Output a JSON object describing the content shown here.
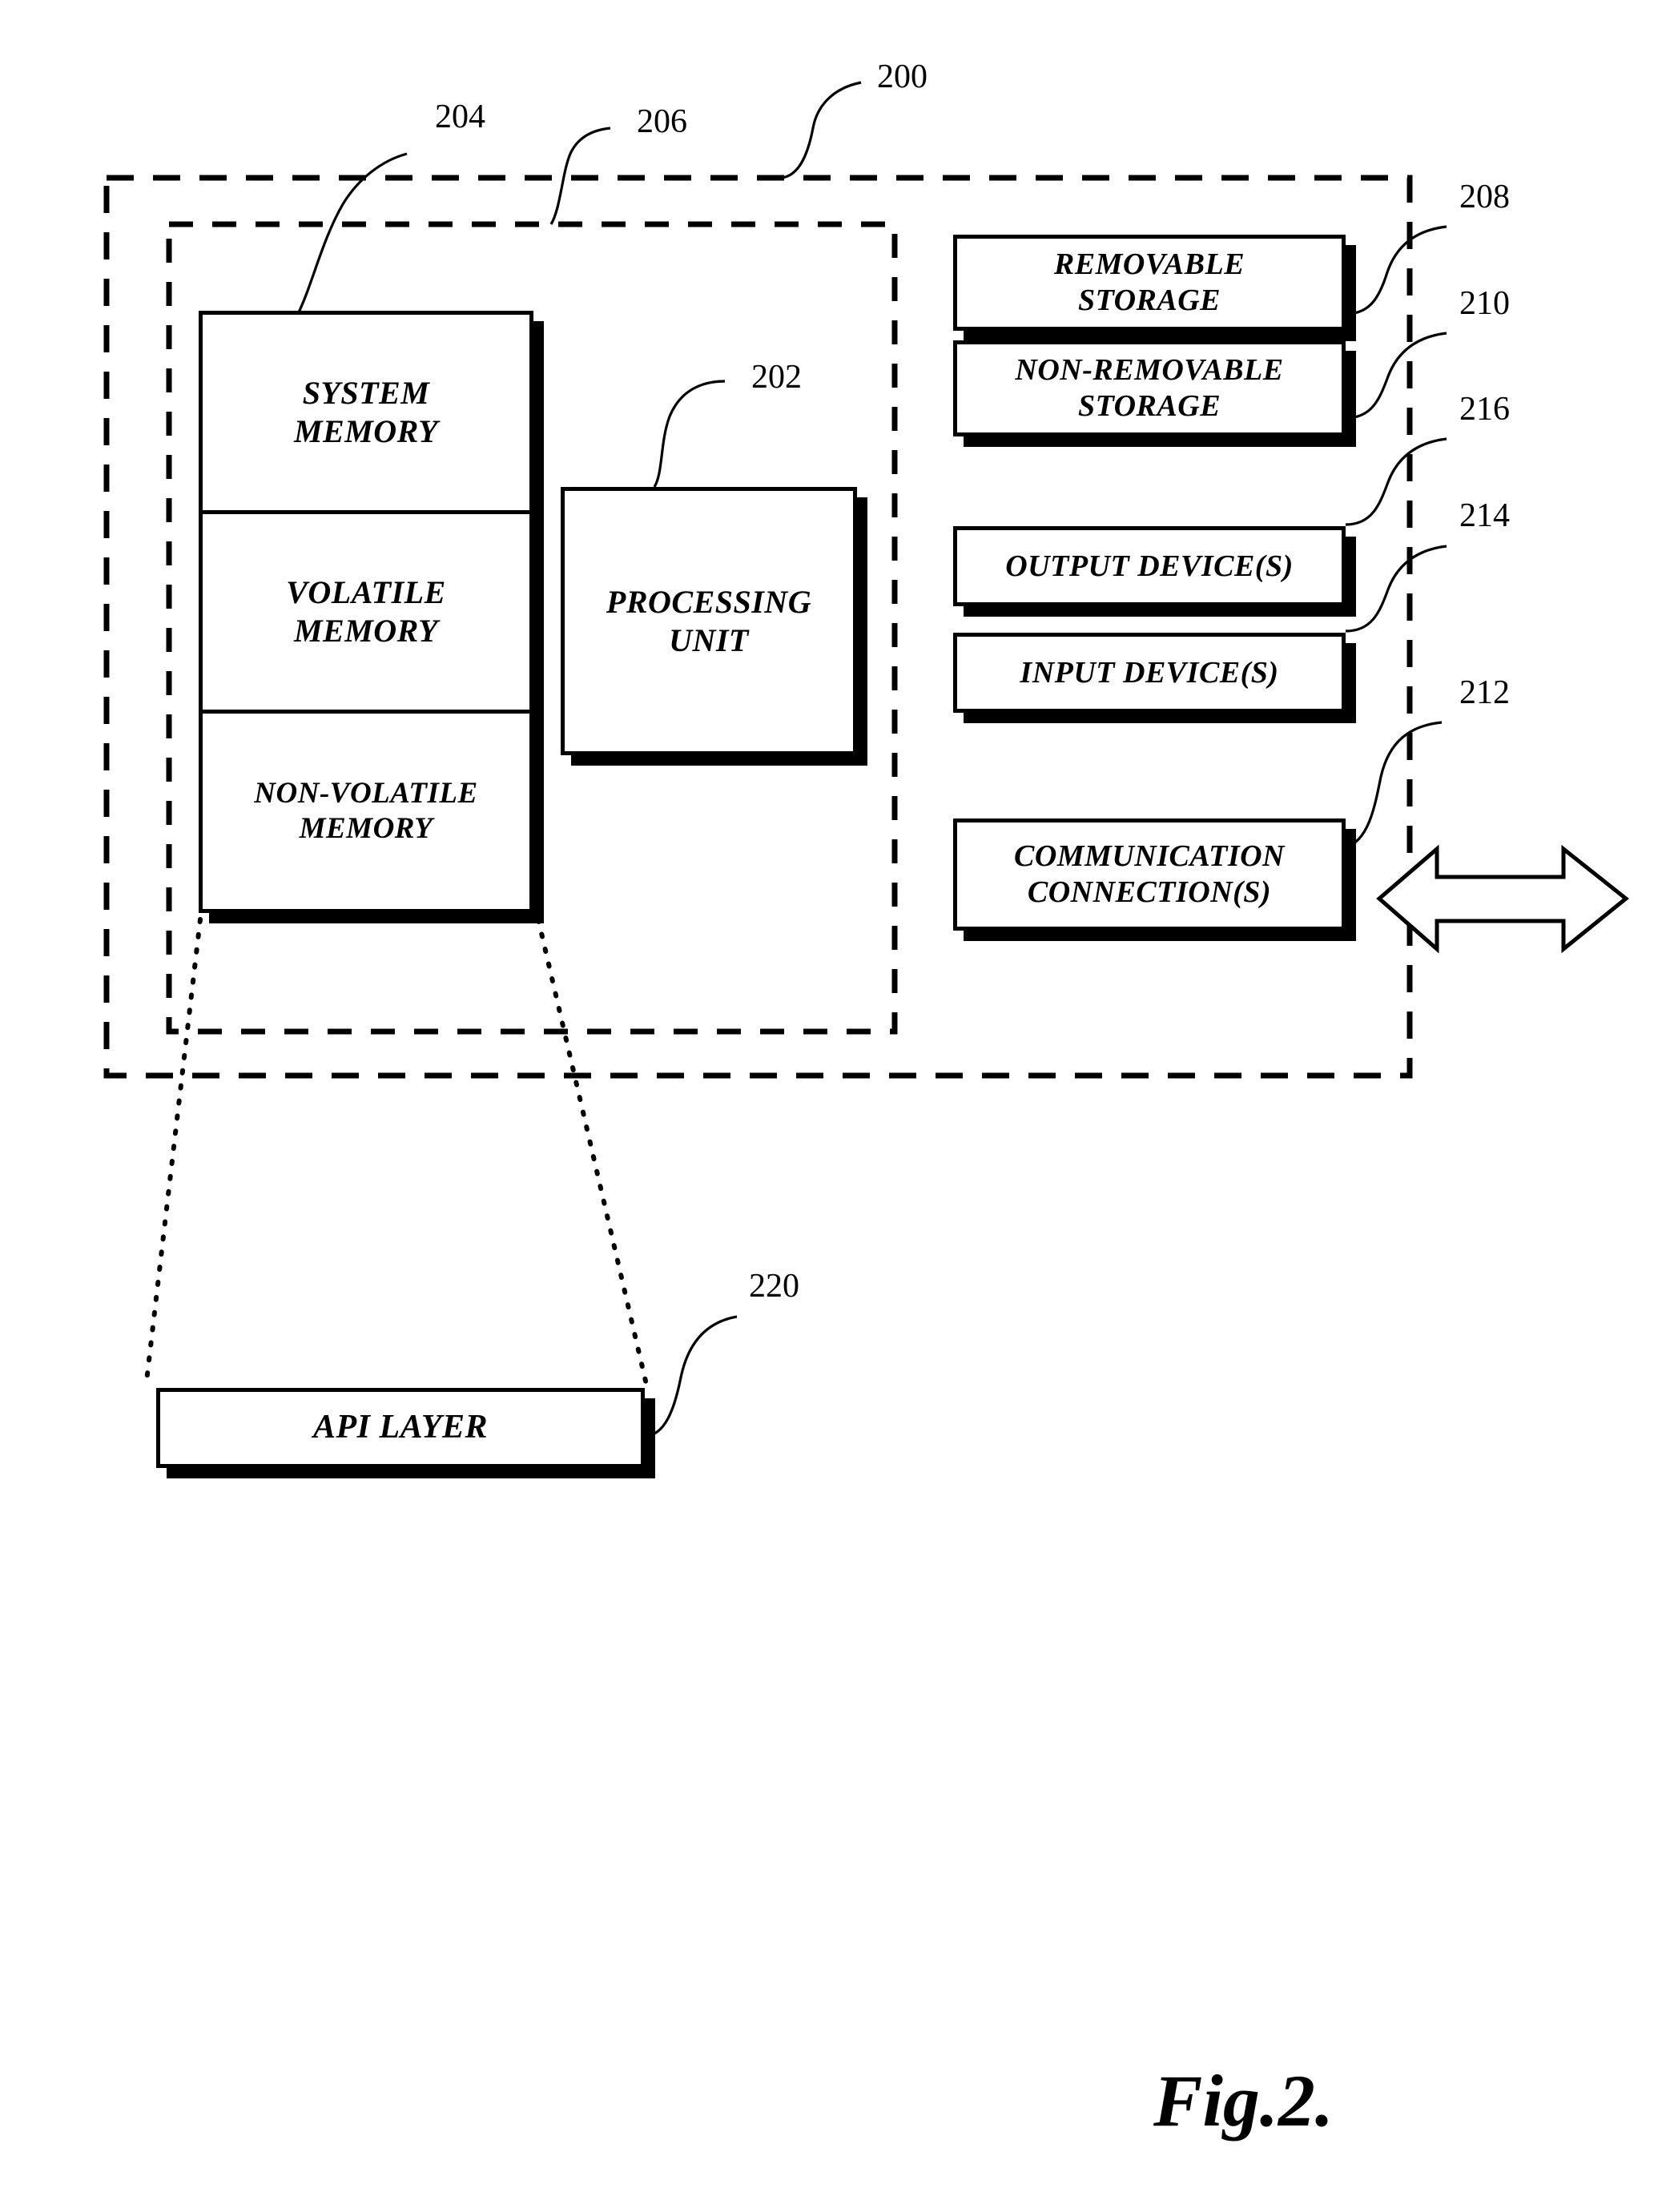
{
  "figure": {
    "caption": "Fig.2.",
    "outer_ref": "200",
    "inner_ref": "206",
    "memory_ref": "204",
    "processing_ref": "202",
    "api_ref": "220"
  },
  "memory_stack": {
    "cells": [
      {
        "label": "SYSTEM\nMEMORY",
        "name": "system-memory"
      },
      {
        "label": "VOLATILE\nMEMORY",
        "name": "volatile-memory"
      },
      {
        "label": "NON-VOLATILE\nMEMORY",
        "name": "non-volatile-memory"
      }
    ]
  },
  "processing_unit": {
    "label": "PROCESSING\nUNIT"
  },
  "peripherals": [
    {
      "label": "REMOVABLE\nSTORAGE",
      "ref": "208",
      "name": "removable-storage"
    },
    {
      "label": "NON-REMOVABLE\nSTORAGE",
      "ref": "210",
      "name": "non-removable-storage"
    },
    {
      "label": "OUTPUT DEVICE(S)",
      "ref": "216",
      "name": "output-devices"
    },
    {
      "label": "INPUT DEVICE(S)",
      "ref": "214",
      "name": "input-devices"
    },
    {
      "label": "COMMUNICATION\nCONNECTION(S)",
      "ref": "212",
      "name": "communication-connections"
    }
  ],
  "api_layer": {
    "label": "API LAYER"
  },
  "colors": {
    "ink": "#000000",
    "paper": "#ffffff"
  }
}
